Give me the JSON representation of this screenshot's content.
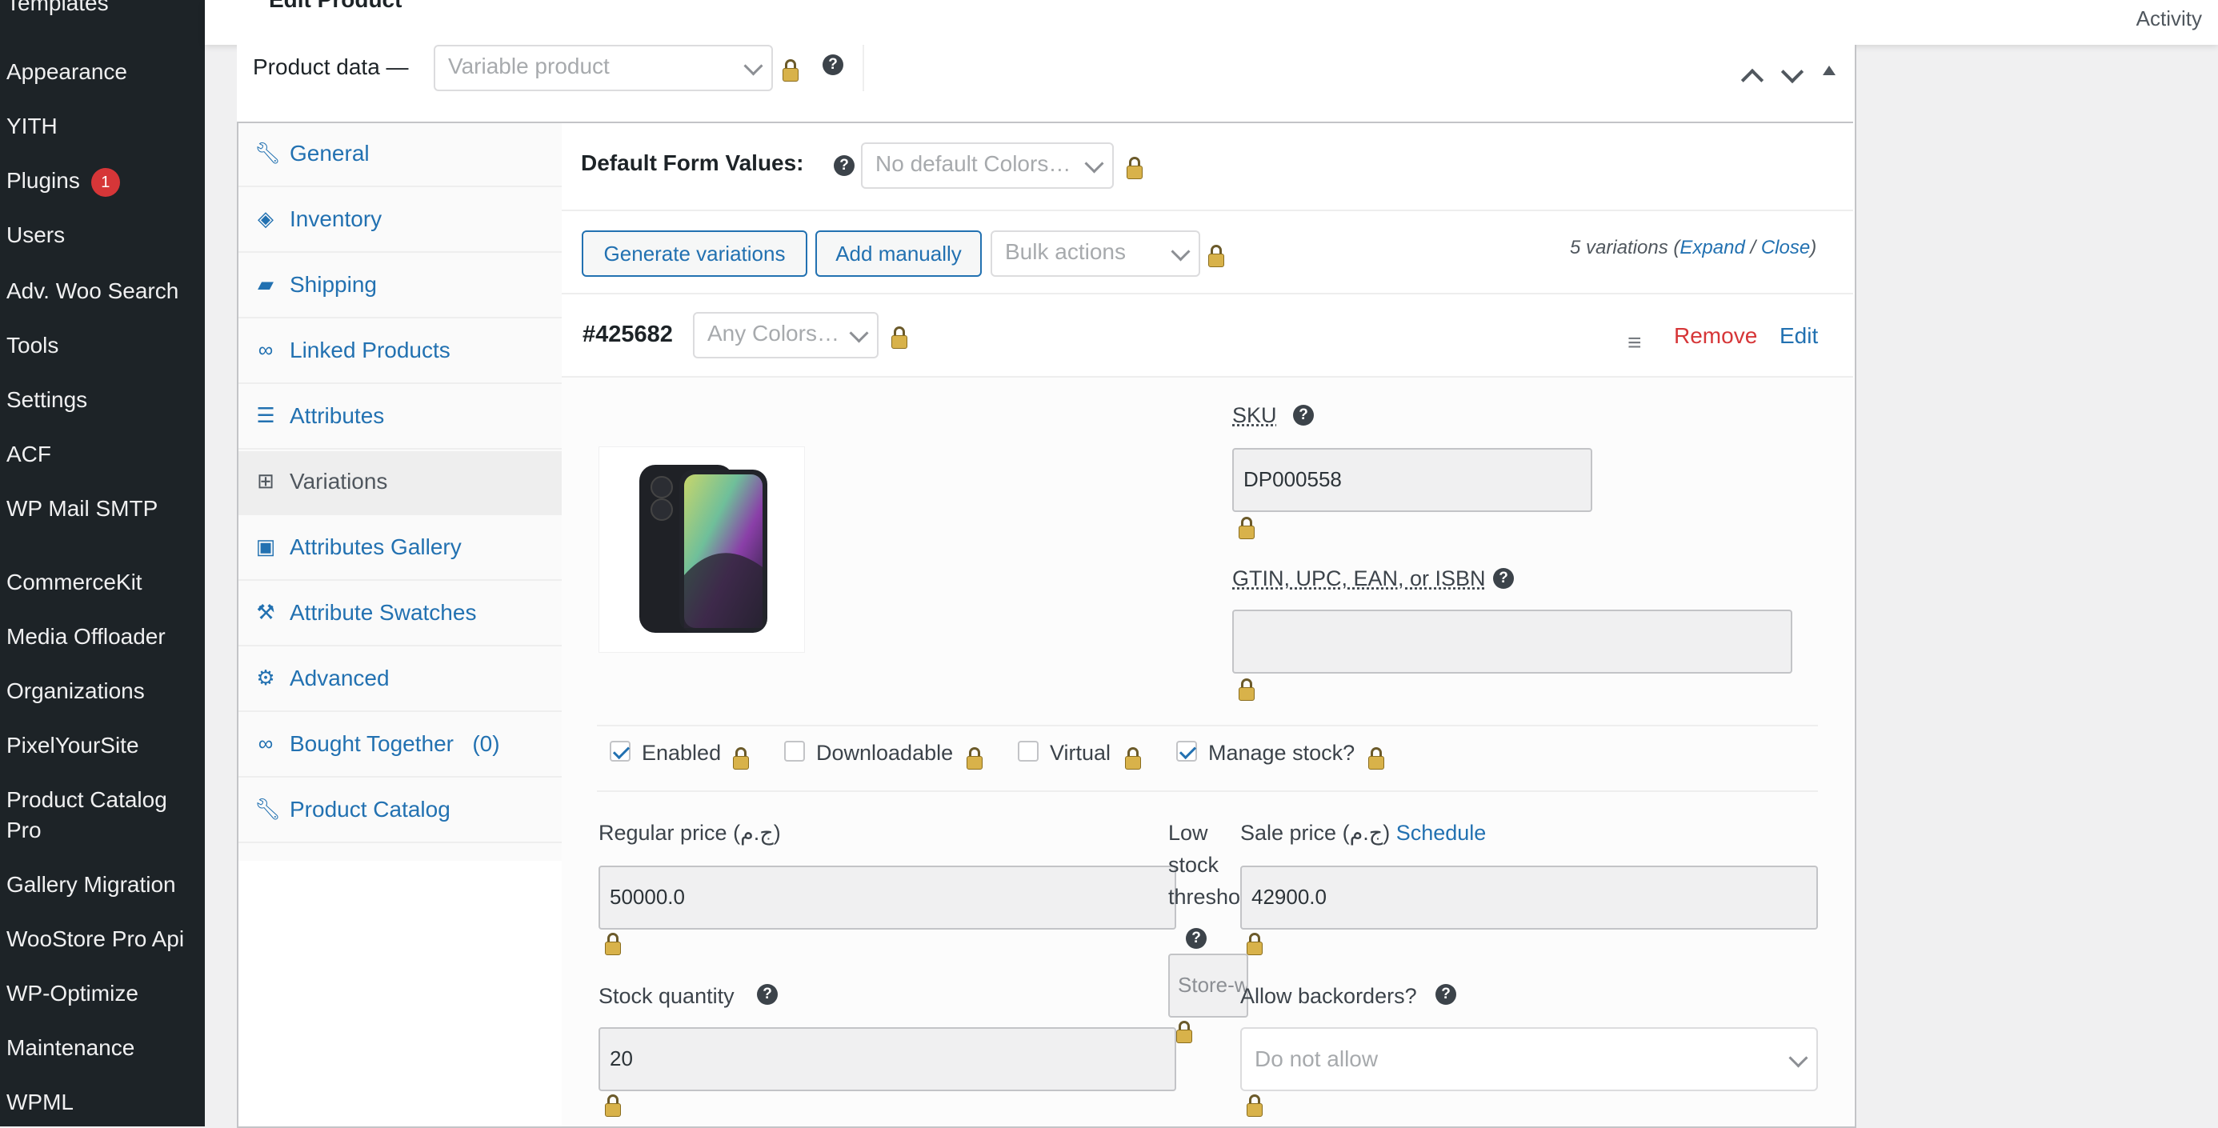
{
  "sidebar": {
    "items": [
      {
        "label": "Templates"
      },
      {
        "label": "Appearance"
      },
      {
        "label": "YITH"
      },
      {
        "label": "Plugins",
        "badge": "1"
      },
      {
        "label": "Users"
      },
      {
        "label": "Adv. Woo Search"
      },
      {
        "label": "Tools"
      },
      {
        "label": "Settings"
      },
      {
        "label": "ACF"
      },
      {
        "label": "WP Mail SMTP"
      },
      {
        "label": "CommerceKit"
      },
      {
        "label": "Media Offloader"
      },
      {
        "label": "Organizations"
      },
      {
        "label": "PixelYourSite"
      },
      {
        "label": "Product Catalog"
      },
      {
        "label": "Pro"
      },
      {
        "label": "Gallery Migration"
      },
      {
        "label": "WooStore Pro Api"
      },
      {
        "label": "WP-Optimize"
      },
      {
        "label": "Maintenance"
      },
      {
        "label": "WPML"
      }
    ]
  },
  "header": {
    "title": "Edit Product",
    "activity": "Activity"
  },
  "product_data": {
    "label": "Product data —",
    "type_value": "Variable product"
  },
  "tabs": [
    {
      "label": "General",
      "icon": "wrench-icon"
    },
    {
      "label": "Inventory",
      "icon": "tag-icon"
    },
    {
      "label": "Shipping",
      "icon": "truck-icon"
    },
    {
      "label": "Linked Products",
      "icon": "link-icon"
    },
    {
      "label": "Attributes",
      "icon": "list-icon"
    },
    {
      "label": "Variations",
      "icon": "grid-icon"
    },
    {
      "label": "Attributes Gallery",
      "icon": "image-icon"
    },
    {
      "label": "Attribute Swatches",
      "icon": "hammer-icon"
    },
    {
      "label": "Advanced",
      "icon": "gear-icon"
    },
    {
      "label": "Bought Together   (0)",
      "icon": "link-icon"
    },
    {
      "label": "Product Catalog",
      "icon": "wrench-icon"
    }
  ],
  "variations": {
    "default_form_label": "Default Form Values:",
    "default_colors": "No default Colors…",
    "generate_btn": "Generate variations",
    "add_manually_btn": "Add manually",
    "bulk_actions": "Bulk actions",
    "count_text": "5 variations",
    "expand": "Expand",
    "slash": "/",
    "close": "Close",
    "paren_open": "(",
    "paren_close": ")"
  },
  "variation": {
    "id": "#425682",
    "any_colors": "Any Colors…",
    "remove": "Remove",
    "edit": "Edit",
    "sku_label": "SKU",
    "sku_value": "DP000558",
    "gtin_label": "GTIN, UPC, EAN, or ISBN",
    "gtin_value": "",
    "enabled": "Enabled",
    "downloadable": "Downloadable",
    "virtual": "Virtual",
    "manage_stock": "Manage stock?",
    "regular_price_label": "Regular price (ج.م)",
    "regular_price_value": "50000.0",
    "low_stock_label_1": "Low",
    "low_stock_label_2": "stock",
    "low_stock_label_3": "threshold",
    "low_stock_placeholder": "Store-wide threshold",
    "sale_price_label": "Sale price (ج.م)",
    "schedule": "Schedule",
    "sale_price_value": "42900.0",
    "stock_qty_label": "Stock quantity",
    "stock_qty_value": "20",
    "backorders_label": "Allow backorders?",
    "backorders_value": "Do not allow"
  },
  "checkbox_states": {
    "enabled": true,
    "downloadable": false,
    "virtual": false,
    "manage_stock": true
  },
  "colors": {
    "accent": "#2271b1",
    "danger": "#d63638",
    "sidebar_bg": "#1d2327"
  }
}
